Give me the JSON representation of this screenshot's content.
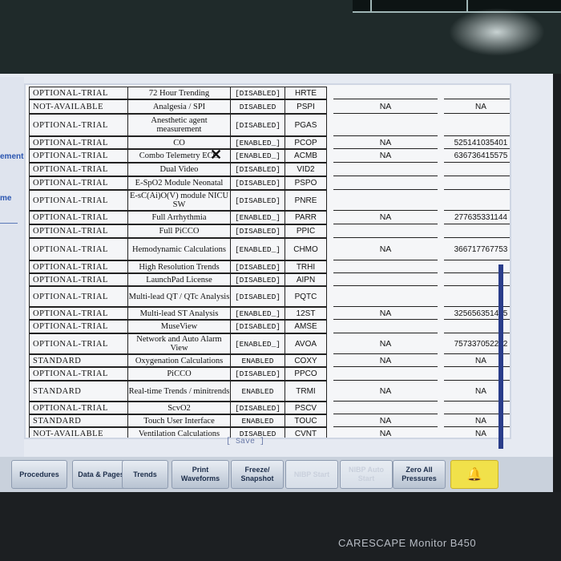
{
  "table": {
    "rows": [
      {
        "status": "OPTIONAL-TRIAL",
        "name": "72 Hour Trending",
        "state": "[DISABLED]",
        "code": "HRTE",
        "na1": "",
        "na2": ""
      },
      {
        "status": "NOT-AVAILABLE",
        "name": "Analgesia / SPI",
        "state": "DISABLED",
        "code": "PSPI",
        "na1": "NA",
        "na2": "NA"
      },
      {
        "status": "OPTIONAL-TRIAL",
        "name": "Anesthetic agent measurement",
        "state": "[DISABLED]",
        "code": "PGAS",
        "na1": "",
        "na2": ""
      },
      {
        "status": "OPTIONAL-TRIAL",
        "name": "CO",
        "state": "[ENABLED_]",
        "code": "PCOP",
        "na1": "NA",
        "na2": "525141035401"
      },
      {
        "status": "OPTIONAL-TRIAL",
        "name": "Combo Telemetry ECG",
        "state": "[ENABLED_]",
        "code": "ACMB",
        "na1": "NA",
        "na2": "636736415575"
      },
      {
        "status": "OPTIONAL-TRIAL",
        "name": "Dual Video",
        "state": "[DISABLED]",
        "code": "VID2",
        "na1": "",
        "na2": ""
      },
      {
        "status": "OPTIONAL-TRIAL",
        "name": "E-SpO2 Module Neonatal",
        "state": "[DISABLED]",
        "code": "PSPO",
        "na1": "",
        "na2": ""
      },
      {
        "status": "OPTIONAL-TRIAL",
        "name": "E-sC(Ai)O(V) module NICU SW",
        "state": "[DISABLED]",
        "code": "PNRE",
        "na1": "",
        "na2": ""
      },
      {
        "status": "OPTIONAL-TRIAL",
        "name": "Full Arrhythmia",
        "state": "[ENABLED_]",
        "code": "PARR",
        "na1": "NA",
        "na2": "277635331144"
      },
      {
        "status": "OPTIONAL-TRIAL",
        "name": "Full PiCCO",
        "state": "[DISABLED]",
        "code": "PPIC",
        "na1": "",
        "na2": ""
      },
      {
        "status": "OPTIONAL-TRIAL",
        "name": "Hemodynamic Calculations",
        "state": "[ENABLED_]",
        "code": "CHMO",
        "na1": "NA",
        "na2": "366717767753"
      },
      {
        "status": "OPTIONAL-TRIAL",
        "name": "High Resolution Trends",
        "state": "[DISABLED]",
        "code": "TRHI",
        "na1": "",
        "na2": ""
      },
      {
        "status": "OPTIONAL-TRIAL",
        "name": "LaunchPad License",
        "state": "[DISABLED]",
        "code": "AIPN",
        "na1": "",
        "na2": ""
      },
      {
        "status": "OPTIONAL-TRIAL",
        "name": "Multi-lead QT / QTc Analysis",
        "state": "[DISABLED]",
        "code": "PQTC",
        "na1": "",
        "na2": ""
      },
      {
        "status": "OPTIONAL-TRIAL",
        "name": "Multi-lead ST Analysis",
        "state": "[ENABLED_]",
        "code": "12ST",
        "na1": "NA",
        "na2": "325656351445"
      },
      {
        "status": "OPTIONAL-TRIAL",
        "name": "MuseView",
        "state": "[DISABLED]",
        "code": "AMSE",
        "na1": "",
        "na2": ""
      },
      {
        "status": "OPTIONAL-TRIAL",
        "name": "Network and Auto Alarm View",
        "state": "[ENABLED_]",
        "code": "AVOA",
        "na1": "NA",
        "na2": "757337052232"
      },
      {
        "status": "STANDARD",
        "name": "Oxygenation Calculations",
        "state": "ENABLED",
        "code": "COXY",
        "na1": "NA",
        "na2": "NA"
      },
      {
        "status": "OPTIONAL-TRIAL",
        "name": "PiCCO",
        "state": "[DISABLED]",
        "code": "PPCO",
        "na1": "",
        "na2": ""
      },
      {
        "status": "STANDARD",
        "name": "Real-time Trends / minitrends",
        "state": "ENABLED",
        "code": "TRMI",
        "na1": "NA",
        "na2": "NA"
      },
      {
        "status": "OPTIONAL-TRIAL",
        "name": "ScvO2",
        "state": "[DISABLED]",
        "code": "PSCV",
        "na1": "",
        "na2": ""
      },
      {
        "status": "STANDARD",
        "name": "Touch User Interface",
        "state": "ENABLED",
        "code": "TOUC",
        "na1": "NA",
        "na2": "NA"
      },
      {
        "status": "NOT-AVAILABLE",
        "name": "Ventilation Calculations",
        "state": "DISABLED",
        "code": "CVNT",
        "na1": "NA",
        "na2": "NA"
      }
    ]
  },
  "side": {
    "label1": "ement",
    "label2": "me"
  },
  "save_label": "[ Save ]",
  "toolbar": {
    "buttons": [
      {
        "label": "Procedures"
      },
      {
        "label": "Data & Pages"
      },
      {
        "label": "Trends"
      },
      {
        "label": "Print Waveforms"
      },
      {
        "label": "Freeze/ Snapshot"
      },
      {
        "label": "NIBP Start"
      },
      {
        "label": "NIBP Auto Start"
      },
      {
        "label": "Zero All Pressures"
      }
    ],
    "alarm_icon": "bell-alarm-icon"
  },
  "brand": "CARESCAPE Monitor B450",
  "colors": {
    "screen": "#e6eaf2",
    "alarm": "#f1e14a",
    "scrollbar": "#2a3d8a"
  }
}
